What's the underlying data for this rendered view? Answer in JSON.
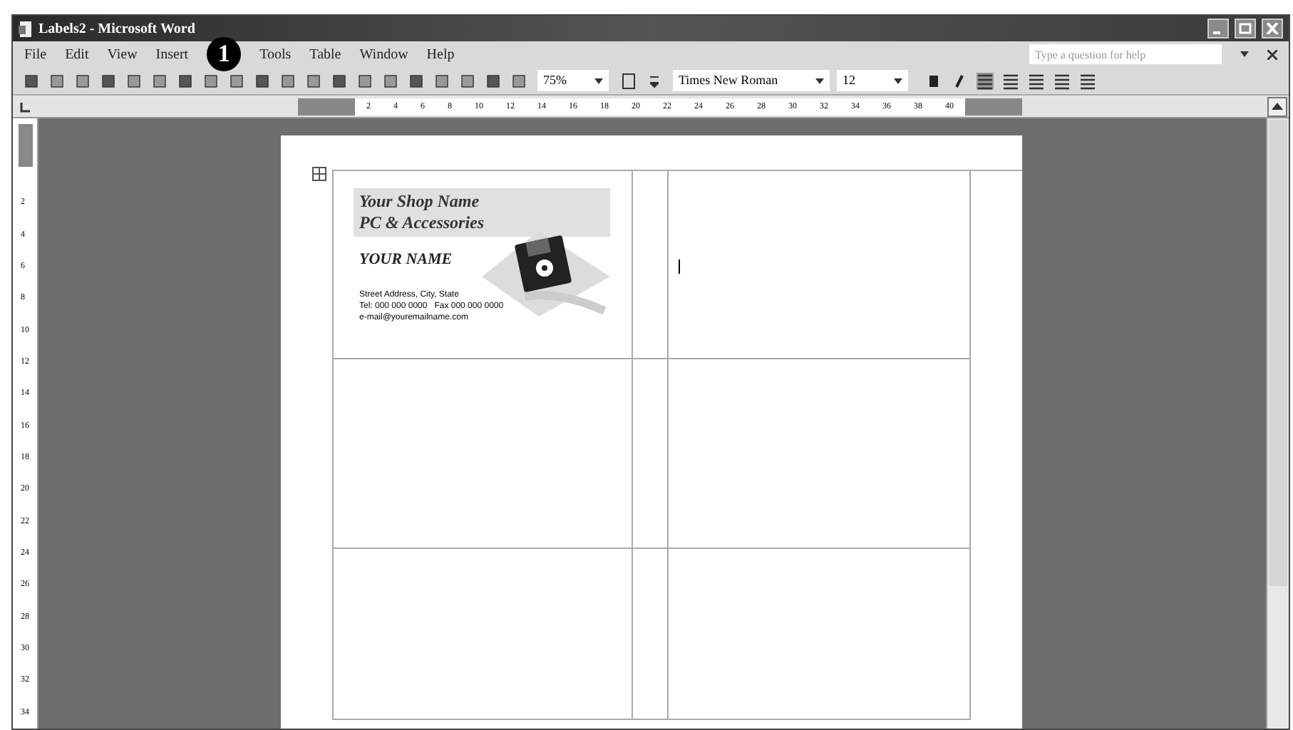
{
  "window": {
    "title": "Labels2 - Microsoft Word"
  },
  "menu": [
    "File",
    "Edit",
    "View",
    "Insert",
    "Tools",
    "Table",
    "Window",
    "Help"
  ],
  "callout": "1",
  "help_box": {
    "placeholder": "Type a question for help"
  },
  "toolbar": {
    "zoom": "75%",
    "font": "Times New Roman",
    "size": "12",
    "bold": false,
    "italic": false
  },
  "ruler": {
    "numbers": [
      "2",
      "4",
      "6",
      "8",
      "10",
      "12",
      "14",
      "16",
      "18",
      "20",
      "22",
      "24",
      "26",
      "28",
      "30",
      "32",
      "34",
      "36",
      "38",
      "40"
    ]
  },
  "vertical_ruler": {
    "numbers": [
      "2",
      "4",
      "6",
      "8",
      "10",
      "12",
      "14",
      "16",
      "18",
      "20",
      "22",
      "24",
      "26",
      "28",
      "30",
      "32",
      "34"
    ]
  },
  "label": {
    "shop_name": "Your Shop Name",
    "tagline": "PC & Accessories",
    "name": "YOUR NAME",
    "lines": [
      "Street Address, City, State",
      "Tel: 000 000 0000   Fax 000 000 0000",
      "e-mail@youremailname.com"
    ]
  }
}
